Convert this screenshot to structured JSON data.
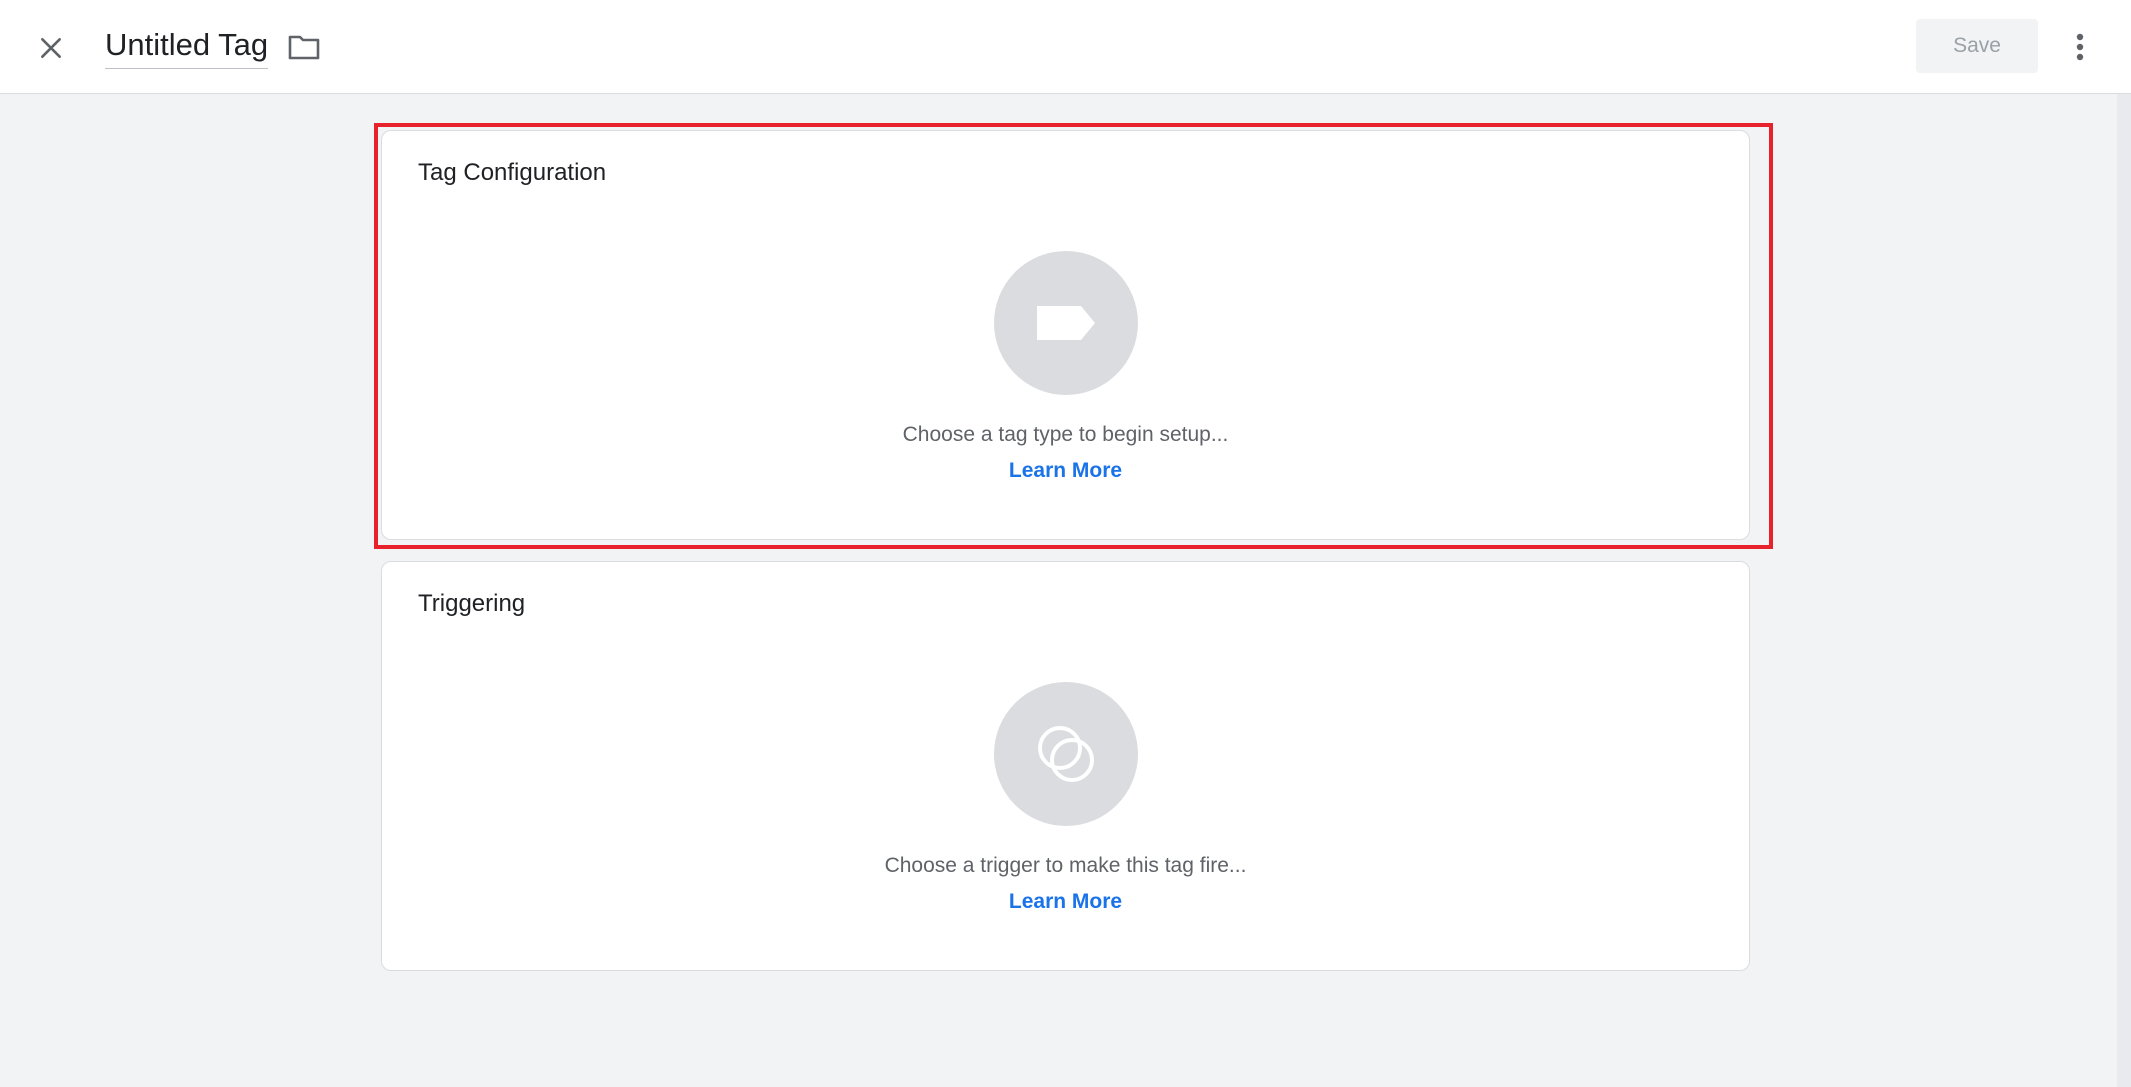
{
  "header": {
    "close_icon": "close-icon",
    "title": "Untitled Tag",
    "folder_icon": "folder-icon",
    "save_label": "Save",
    "more_icon": "more-vert-icon"
  },
  "tag_configuration": {
    "title": "Tag Configuration",
    "icon": "tag-icon",
    "hint": "Choose a tag type to begin setup...",
    "link": "Learn More",
    "highlighted": true,
    "highlight_color": "#e8222c"
  },
  "triggering": {
    "title": "Triggering",
    "icon": "trigger-icon",
    "hint": "Choose a trigger to make this tag fire...",
    "link": "Learn More"
  },
  "colors": {
    "background": "#f1f3f4",
    "card": "#ffffff",
    "link": "#1a73e8",
    "placeholder": "#dadce0"
  }
}
